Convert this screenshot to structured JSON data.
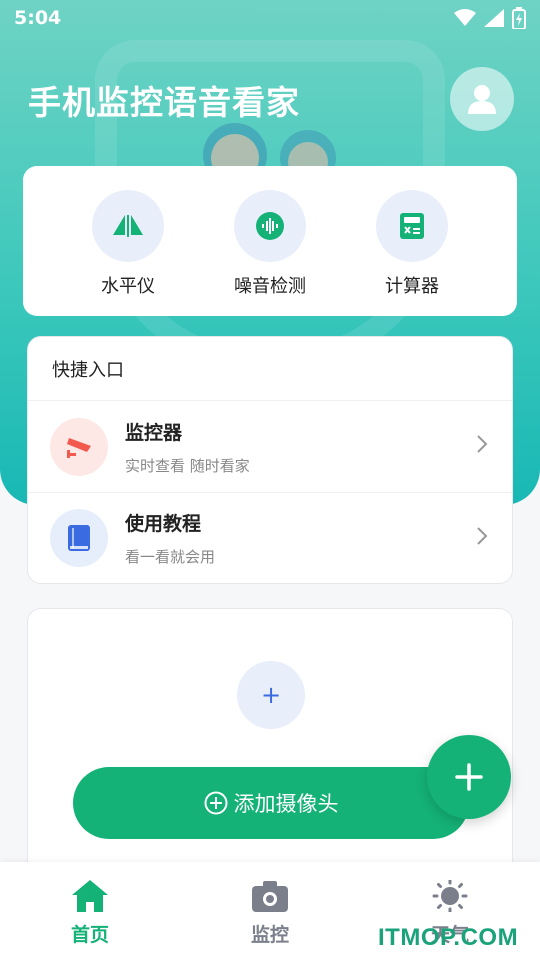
{
  "status_bar": {
    "time": "5:04"
  },
  "header": {
    "title": "手机监控语音看家"
  },
  "tools": [
    {
      "label": "水平仪",
      "icon": "level-icon"
    },
    {
      "label": "噪音检测",
      "icon": "sound-wave-icon"
    },
    {
      "label": "计算器",
      "icon": "calculator-icon"
    }
  ],
  "quick_entry": {
    "title": "快捷入口",
    "items": [
      {
        "title": "监控器",
        "subtitle": "实时查看 随时看家",
        "icon": "cctv-camera-icon"
      },
      {
        "title": "使用教程",
        "subtitle": "看一看就会用",
        "icon": "book-icon"
      }
    ]
  },
  "camera_card": {
    "plus": "+",
    "add_button_label": "添加摄像头"
  },
  "bottom_nav": [
    {
      "label": "首页",
      "icon": "home-icon",
      "active": true
    },
    {
      "label": "监控",
      "icon": "camera-icon",
      "active": false
    },
    {
      "label": "天气",
      "icon": "sun-icon",
      "active": false
    }
  ],
  "watermark": "ITMOP.COM",
  "colors": {
    "accent": "#14b277",
    "hero": "#3ec8bc",
    "inactive": "#7b7f8c"
  }
}
